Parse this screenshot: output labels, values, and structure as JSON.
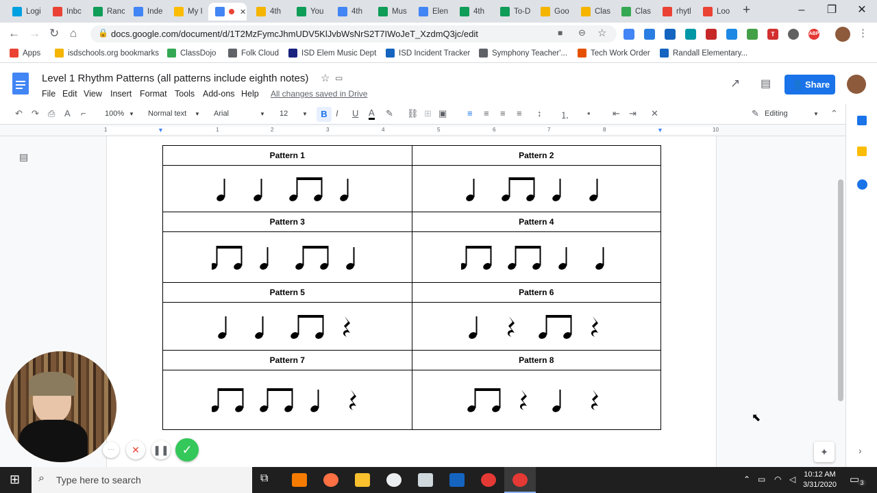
{
  "browser": {
    "tabs": [
      {
        "label": "Logi",
        "color": "#00a1e0"
      },
      {
        "label": "Inbc",
        "color": "#ea4335"
      },
      {
        "label": "Ranc",
        "color": "#0f9d58"
      },
      {
        "label": "Inde",
        "color": "#4285f4"
      },
      {
        "label": "My I",
        "color": "#fbbc04"
      },
      {
        "label": "",
        "color": "#4285f4"
      },
      {
        "label": "4th",
        "color": "#f4b400"
      },
      {
        "label": "You",
        "color": "#0f9d58"
      },
      {
        "label": "4th",
        "color": "#4285f4"
      },
      {
        "label": "Mus",
        "color": "#0f9d58"
      },
      {
        "label": "Elen",
        "color": "#4285f4"
      },
      {
        "label": "4th",
        "color": "#0f9d58"
      },
      {
        "label": "To-D",
        "color": "#0f9d58"
      },
      {
        "label": "Goo",
        "color": "#f4b400"
      },
      {
        "label": "Clas",
        "color": "#f4b400"
      },
      {
        "label": "Clas",
        "color": "#34a853"
      },
      {
        "label": "rhytl",
        "color": "#ea4335"
      },
      {
        "label": "Loo",
        "color": "#ea4335"
      }
    ],
    "url": "docs.google.com/document/d/1T2MzFymcJhmUDV5KlJvbWsNrS2T7IWoJeT_XzdmQ3jc/edit",
    "bookmarks": [
      "Apps",
      "isdschools.org bookmarks",
      "ClassDojo",
      "Folk Cloud",
      "ISD Elem Music Dept",
      "ISD Incident Tracker",
      "Symphony Teacher'...",
      "Tech Work Order",
      "Randall Elementary..."
    ]
  },
  "doc": {
    "title": "Level 1 Rhythm Patterns (all patterns include eighth notes)",
    "menus": [
      "File",
      "Edit",
      "View",
      "Insert",
      "Format",
      "Tools",
      "Add-ons",
      "Help"
    ],
    "saved_status": "All changes saved in Drive",
    "share_label": "Share",
    "toolbar": {
      "zoom": "100%",
      "style": "Normal text",
      "font": "Arial",
      "size": "12",
      "mode": "Editing"
    },
    "ruler_numbers": [
      "1",
      "1",
      "2",
      "3",
      "4",
      "5",
      "6",
      "7",
      "8",
      "10"
    ]
  },
  "patterns": [
    {
      "title": "Pattern 1",
      "rhythm": [
        "quarter",
        "quarter",
        "eighth-pair",
        "quarter"
      ]
    },
    {
      "title": "Pattern 2",
      "rhythm": [
        "quarter",
        "eighth-pair",
        "quarter",
        "quarter"
      ]
    },
    {
      "title": "Pattern 3",
      "rhythm": [
        "eighth-pair",
        "quarter",
        "eighth-pair",
        "quarter"
      ]
    },
    {
      "title": "Pattern 4",
      "rhythm": [
        "eighth-pair",
        "eighth-pair",
        "quarter",
        "quarter"
      ]
    },
    {
      "title": "Pattern 5",
      "rhythm": [
        "quarter",
        "quarter",
        "eighth-pair",
        "rest"
      ]
    },
    {
      "title": "Pattern 6",
      "rhythm": [
        "quarter",
        "rest",
        "eighth-pair",
        "rest"
      ]
    },
    {
      "title": "Pattern 7",
      "rhythm": [
        "eighth-pair",
        "eighth-pair",
        "quarter",
        "rest"
      ]
    },
    {
      "title": "Pattern 8",
      "rhythm": [
        "eighth-pair",
        "rest",
        "quarter",
        "rest"
      ]
    }
  ],
  "taskbar": {
    "search_placeholder": "Type here to search",
    "time": "10:12 AM",
    "date": "3/31/2020",
    "notifications": "3"
  }
}
